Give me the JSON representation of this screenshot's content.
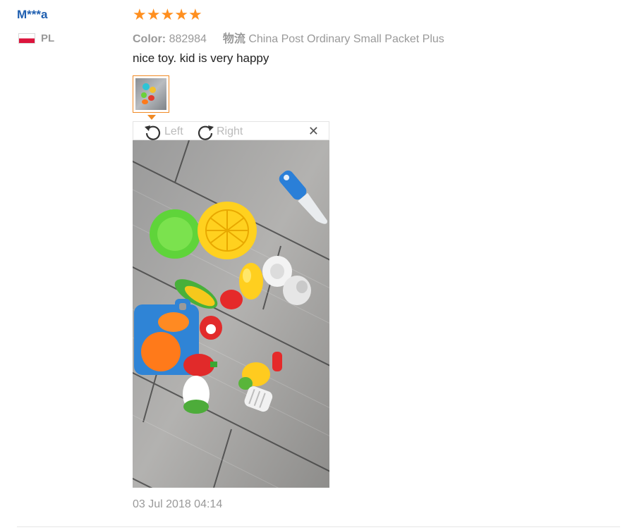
{
  "review": {
    "user_name": "M***a",
    "country_code": "PL",
    "rating": 5,
    "stars": [
      "★",
      "★",
      "★",
      "★",
      "★"
    ],
    "color_label": "Color:",
    "color_value": "882984",
    "shipping_label": "物流",
    "shipping_value": "China Post Ordinary Small Packet Plus",
    "text": "nice toy. kid is very happy",
    "date": "03 Jul 2018 04:14"
  },
  "viewer": {
    "rotate_left_label": "Left",
    "rotate_right_label": "Right",
    "close_symbol": "✕"
  },
  "colors": {
    "accent": "#f08a24",
    "star": "#ff8f1f",
    "user_link": "#1f5fb0",
    "muted_text": "#999999"
  }
}
